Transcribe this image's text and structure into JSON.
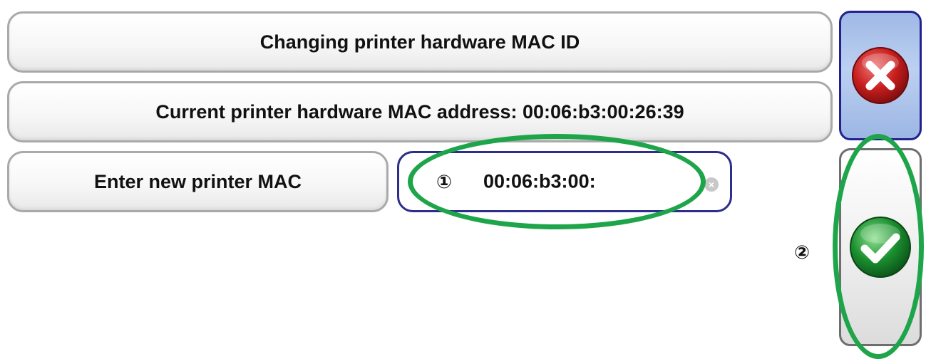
{
  "dialog": {
    "title": "Changing printer hardware MAC ID",
    "current_address": "Current printer hardware MAC address: 00:06:b3:00:26:39",
    "enter_label": "Enter new printer MAC",
    "mac_input_value": "00:06:b3:00:"
  },
  "buttons": {
    "cancel_icon": "red-x-circle-icon",
    "confirm_icon": "green-check-circle-icon"
  },
  "callouts": {
    "marker_1": "①",
    "marker_2": "②"
  },
  "colors": {
    "cancel_bg": "#9fb9e6",
    "input_border": "#2d2d8c",
    "callout_green": "#1ea54a",
    "cancel_red": "#c81e1e",
    "confirm_green": "#1a8f2f"
  }
}
